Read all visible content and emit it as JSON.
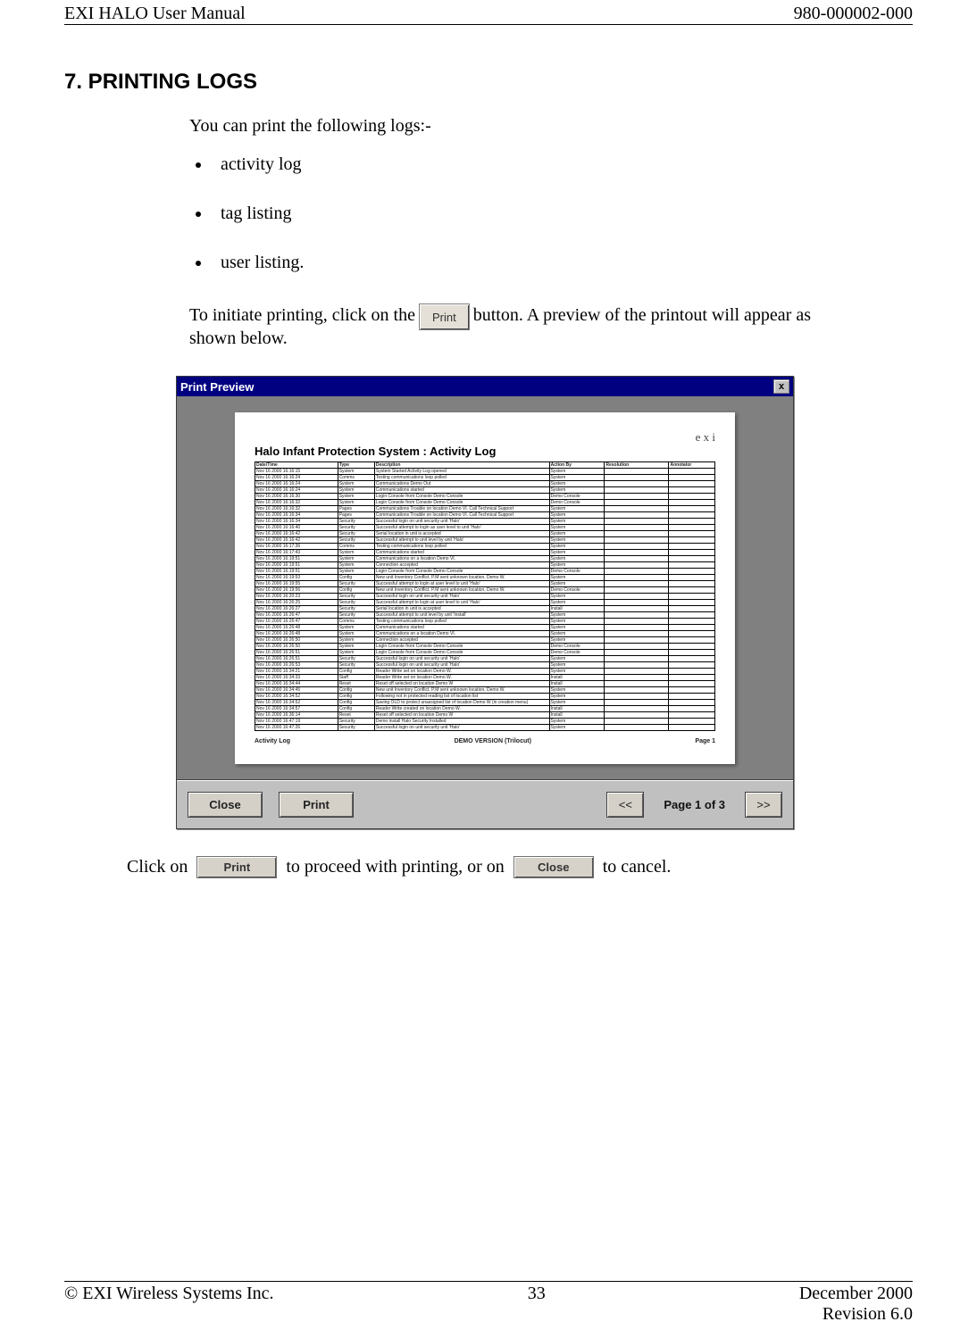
{
  "header": {
    "left": "EXI HALO User Manual",
    "right": "980-000002-000"
  },
  "section": {
    "number_title": "7.  PRINTING LOGS",
    "intro": "You can print the following logs:-",
    "bullets": [
      "activity log",
      "tag listing",
      "user listing."
    ],
    "print_sentence_before": "To initiate printing, click on the ",
    "print_btn_label": "Print",
    "print_sentence_after1": " button.  A preview of the printout will appear as",
    "print_sentence_after2": "shown below."
  },
  "screenshot": {
    "window_title": "Print Preview",
    "close_x": "x",
    "logo_text": "e x i",
    "report_title": "Halo Infant Protection System : Activity Log",
    "table": {
      "headers": [
        "Date/Time",
        "Type",
        "Description",
        "Action By",
        "Resolution",
        "Annotator"
      ],
      "rows": [
        [
          "Nov 16 2000  16:16:15",
          "System",
          "System Started Activity Log opened",
          "System",
          "",
          ""
        ],
        [
          "Nov 16 2000  16:16:24",
          "Comms",
          "Testing communications loop polled",
          "System",
          "",
          ""
        ],
        [
          "Nov 16 2000  16:16:24",
          "System",
          "Communications Demo Out",
          "System",
          "",
          ""
        ],
        [
          "Nov 16 2000  16:16:24",
          "System",
          "Communications started",
          "System",
          "",
          ""
        ],
        [
          "Nov 16 2000  16:16:30",
          "System",
          "Login Console from Console Demo Console",
          "Demo Console",
          "",
          ""
        ],
        [
          "Nov 16 2000  16:16:32",
          "System",
          "Login Console from Console Demo Console",
          "Demo Console",
          "",
          ""
        ],
        [
          "Nov 16 2000  16:16:32",
          "Pages",
          "Communications Trouble on location Demo VI. Call Technical Support",
          "System",
          "",
          ""
        ],
        [
          "Nov 16 2000  16:16:34",
          "Pages",
          "Communications Trouble on location Demo VI. Call Technical Support",
          "System",
          "",
          ""
        ],
        [
          "Nov 16 2000  16:16:34",
          "Security",
          "Successful login on unit security unit 'Halo'",
          "System",
          "",
          ""
        ],
        [
          "Nov 16 2000  16:16:40",
          "Security",
          "Successful attempt to login as user level to unit 'Halo'",
          "System",
          "",
          ""
        ],
        [
          "Nov 16 2000  16:16:42",
          "Security",
          "Serial location in unit is accepted",
          "System",
          "",
          ""
        ],
        [
          "Nov 16 2000  16:16:42",
          "Security",
          "Successful attempt to unit level by unit 'Halo'",
          "System",
          "",
          ""
        ],
        [
          "Nov 16 2000  16:17:36",
          "Comms",
          "Testing communications loop polled",
          "System",
          "",
          ""
        ],
        [
          "Nov 16 2000  16:17:43",
          "System",
          "Communications started",
          "System",
          "",
          ""
        ],
        [
          "Nov 16 2000  16:19:51",
          "System",
          "Communications on a location Demo VI.",
          "System",
          "",
          ""
        ],
        [
          "Nov 16 2000  16:19:51",
          "System",
          "Connection accepted",
          "System",
          "",
          ""
        ],
        [
          "Nov 16 2000  16:19:51",
          "System",
          "Login Console from Console Demo Console",
          "Demo Console",
          "",
          ""
        ],
        [
          "Nov 16 2000  16:19:53",
          "Config",
          "New unit Inventory Conflict. P.M sent unknown location, Demo W.",
          "System",
          "",
          ""
        ],
        [
          "Nov 16 2000  16:19:55",
          "Security",
          "Successful attempt to login at user level to unit 'Halo'",
          "System",
          "",
          ""
        ],
        [
          "Nov 16 2000  16:19:56",
          "Config",
          "New unit Inventory Conflict. P.M sent unknown location, Demo W.",
          "Demo Console",
          "",
          ""
        ],
        [
          "Nov 16 2000  16:20:23",
          "Security",
          "Successful login on unit security unit 'Halo'",
          "System",
          "",
          ""
        ],
        [
          "Nov 16 2000  16:26:25",
          "Security",
          "Successful attempt to login at user level to unit 'Halo'",
          "System",
          "",
          ""
        ],
        [
          "Nov 16 2000  16:26:27",
          "Security",
          "Serial location in unit is accepted",
          "Install",
          "",
          ""
        ],
        [
          "Nov 16 2000  16:26:47",
          "Security",
          "Successful attempt to unit level by unit 'Install'",
          "System",
          "",
          ""
        ],
        [
          "Nov 16 2000  16:26:47",
          "Comms",
          "Testing communications loop polled",
          "System",
          "",
          ""
        ],
        [
          "Nov 16 2000  16:26:48",
          "System",
          "Communications started",
          "System",
          "",
          ""
        ],
        [
          "Nov 16 2000  16:26:48",
          "System",
          "Communications on a location Demo VI.",
          "System",
          "",
          ""
        ],
        [
          "Nov 16 2000  16:26:50",
          "System",
          "Connection accepted",
          "System",
          "",
          ""
        ],
        [
          "Nov 16 2000  16:26:50",
          "System",
          "Login Console from Console Demo Console",
          "Demo Console",
          "",
          ""
        ],
        [
          "Nov 16 2000  16:26:51",
          "System",
          "Login Console from Console Demo Console",
          "Demo Console",
          "",
          ""
        ],
        [
          "Nov 16 2000  16:26:51",
          "Security",
          "Successful login on unit security unit 'Halo'",
          "System",
          "",
          ""
        ],
        [
          "Nov 16 2000  16:26:53",
          "Security",
          "Successful login on unit security unit 'Halo'",
          "System",
          "",
          ""
        ],
        [
          "Nov 16 2000  16:34:21",
          "Config",
          "Reader Write set on location Demo W.",
          "System",
          "",
          ""
        ],
        [
          "Nov 16 2000  16:34:33",
          "Staff",
          "Reader Write set on location Demo W.",
          "Install",
          "",
          ""
        ],
        [
          "Nov 16 2000  16:34:44",
          "Reset",
          "Reset off selected on location Demo W",
          "Install",
          "",
          ""
        ],
        [
          "Nov 16 2000  16:34:45",
          "Config",
          "New unit Inventory Conflict. P.M sent unknown location, Demo W.",
          "System",
          "",
          ""
        ],
        [
          "Nov 16 2000  16:34:52",
          "Config",
          "Following not in protected reading list of location list",
          "System",
          "",
          ""
        ],
        [
          "Nov 16 2000  16:34:52",
          "Config",
          "Saving OLD to protect unassigned list of location Demo W (in creation menu)",
          "System",
          "",
          ""
        ],
        [
          "Nov 16 2000  16:34:57",
          "Config",
          "Reader Write created on location Demo W.",
          "Install",
          "",
          ""
        ],
        [
          "Nov 16 2000  16:36:14",
          "Reset",
          "Reset off selected on location Demo W",
          "Install",
          "",
          ""
        ],
        [
          "Nov 16 2000  16:47:19",
          "Security",
          "Demo install Halo Security Installed",
          "System",
          "",
          ""
        ],
        [
          "Nov 16 2000  16:47:26",
          "Security",
          "Successful login on unit security unit 'Halo'",
          "System",
          "",
          ""
        ]
      ]
    },
    "paper_footer": {
      "left": "Activity Log",
      "center": "DEMO VERSION (Trilocut)",
      "right": "Page 1"
    },
    "toolbar": {
      "close": "Close",
      "print": "Print",
      "prev": "<<",
      "page_label": "Page 1 of 3",
      "next": ">>"
    }
  },
  "post": {
    "click_on": "Click on ",
    "print_btn": "Print",
    "mid": " to proceed with printing, or on ",
    "close_btn": "Close",
    "end": " to cancel."
  },
  "footer": {
    "left": "© EXI Wireless Systems Inc.",
    "center": "33",
    "right": "December 2000",
    "revision": "Revision 6.0"
  }
}
